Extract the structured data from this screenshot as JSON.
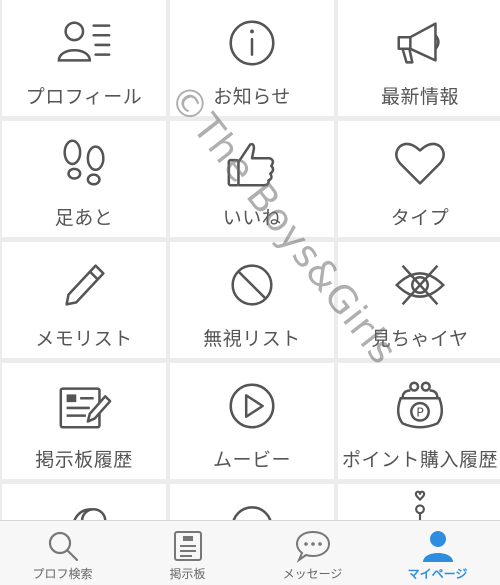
{
  "menu": [
    {
      "label": "プロフィール",
      "icon": "profile-icon"
    },
    {
      "label": "お知らせ",
      "icon": "info-icon"
    },
    {
      "label": "最新情報",
      "icon": "megaphone-icon"
    },
    {
      "label": "足あと",
      "icon": "footprints-icon"
    },
    {
      "label": "いいね",
      "icon": "thumbs-up-icon"
    },
    {
      "label": "タイプ",
      "icon": "heart-icon"
    },
    {
      "label": "メモリスト",
      "icon": "pencil-icon"
    },
    {
      "label": "無視リスト",
      "icon": "block-icon"
    },
    {
      "label": "見ちゃイヤ",
      "icon": "hidden-eye-icon"
    },
    {
      "label": "掲示板履歴",
      "icon": "board-history-icon"
    },
    {
      "label": "ムービー",
      "icon": "play-icon"
    },
    {
      "label": "ポイント購入履歴",
      "icon": "coin-purse-icon"
    }
  ],
  "watermark": "©The Boys&Girls",
  "tabbar": {
    "items": [
      {
        "label": "プロフ検索",
        "icon": "search-icon",
        "active": false
      },
      {
        "label": "掲示板",
        "icon": "bulletin-board-icon",
        "active": false
      },
      {
        "label": "メッセージ",
        "icon": "chat-bubble-icon",
        "active": false
      },
      {
        "label": "マイページ",
        "icon": "person-icon",
        "active": true
      }
    ],
    "active_color": "#2f8de0"
  },
  "colors": {
    "icon": "#555555",
    "tile": "#ffffff",
    "grid_gap": "#ececec"
  }
}
